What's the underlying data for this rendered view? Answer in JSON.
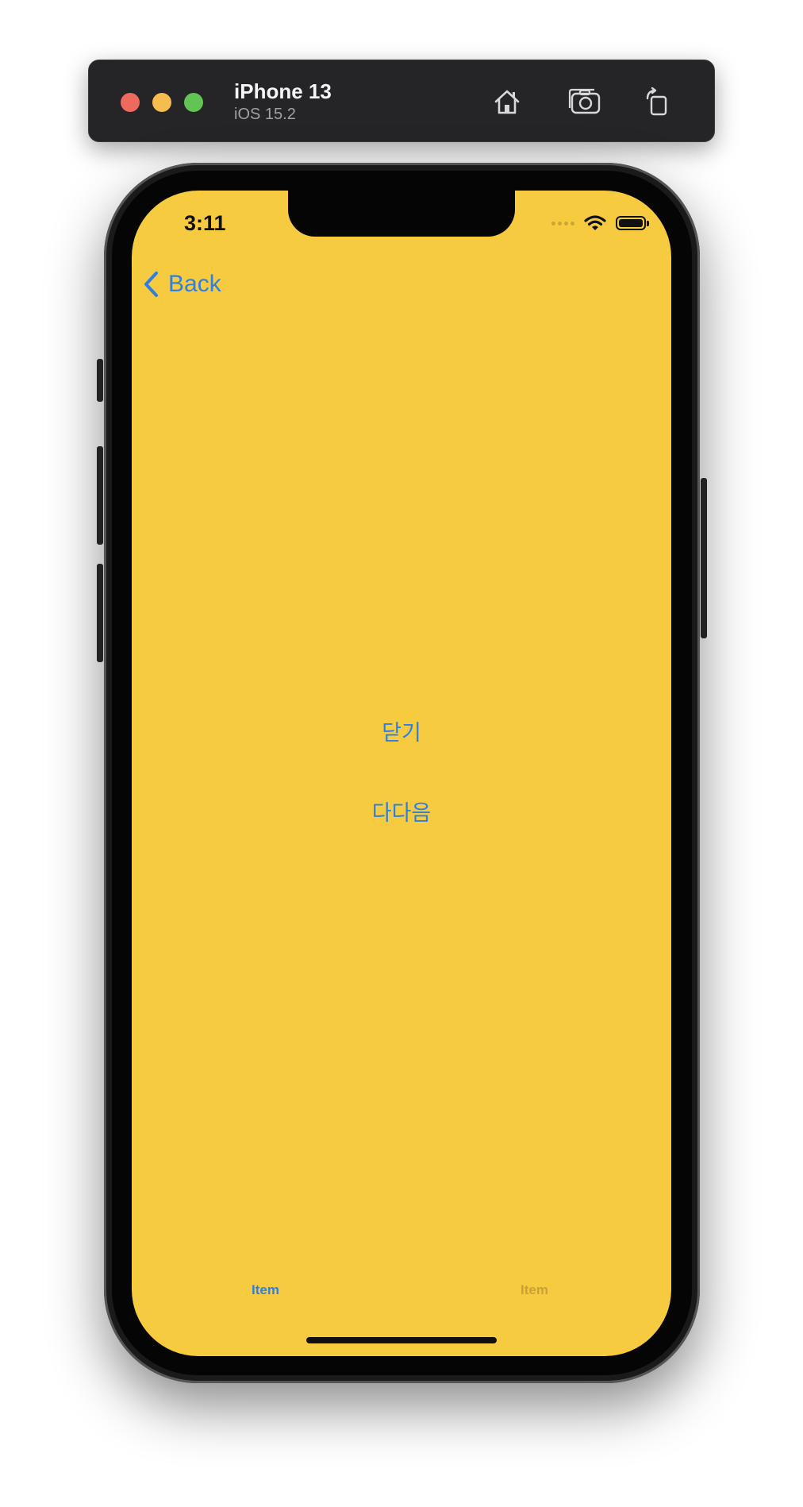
{
  "simulator": {
    "device_name": "iPhone 13",
    "os_version": "iOS 15.2",
    "colors": {
      "toolbar_bg": "#252527",
      "close": "#ee6a5f",
      "minimize": "#f5bd4f",
      "maximize": "#61c454"
    },
    "toolbar_icons": [
      "home-icon",
      "screenshot-icon",
      "rotate-icon"
    ]
  },
  "status_bar": {
    "time": "3:11",
    "icons": [
      "cellular-signal-icon",
      "wifi-icon",
      "battery-icon"
    ]
  },
  "navigation": {
    "back_label": "Back"
  },
  "content": {
    "close_button_label": "닫기",
    "next_button_label": "다다음",
    "background_color": "#f6cb40",
    "tint_color": "#2f7fe0"
  },
  "tab_bar": {
    "items": [
      {
        "label": "Item",
        "selected": true
      },
      {
        "label": "Item",
        "selected": false
      }
    ]
  }
}
